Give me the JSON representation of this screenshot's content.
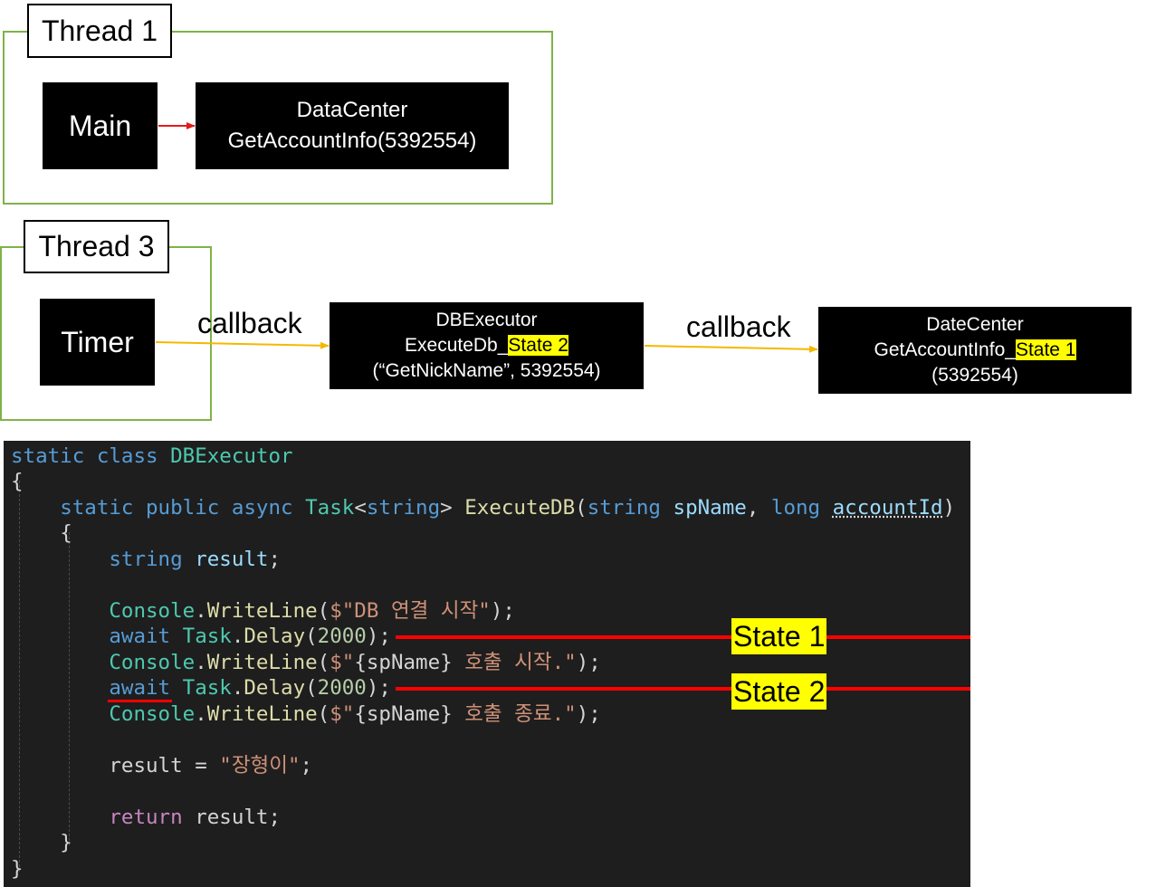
{
  "thread1": {
    "title": "Thread 1",
    "main_label": "Main",
    "datacenter": {
      "line1": "DataCenter",
      "line2": "GetAccountInfo(5392554)"
    }
  },
  "thread3": {
    "title": "Thread 3",
    "timer_label": "Timer",
    "callback1": "callback",
    "callback2": "callback",
    "dbexecutor": {
      "line1": "DBExecutor",
      "line2_prefix": "ExecuteDb_",
      "line2_state": "State 2",
      "line3": "(“GetNickName”, 5392554)"
    },
    "datecenter": {
      "line1": "DateCenter",
      "line2_prefix": "GetAccountInfo_",
      "line2_state": "State 1",
      "line3": "(5392554)"
    }
  },
  "code": {
    "l1_static": "static",
    "l1_class": "class",
    "l1_name": "DBExecutor",
    "brace_open": "{",
    "l3_static": "static",
    "l3_public": "public",
    "l3_async": "async",
    "l3_task": "Task",
    "l3_lt": "<",
    "l3_string": "string",
    "l3_gt": ">",
    "l3_method": "ExecuteDB",
    "l3_paren": "(",
    "l3_string2": "string",
    "l3_p1": "spName",
    "l3_comma": ",",
    "l3_long": "long",
    "l3_p2": "accountId",
    "l3_close": ")",
    "l4_brace": "{",
    "l5_string": "string",
    "l5_var": "result",
    "l5_semi": ";",
    "l7_console": "Console",
    "l7_dot": ".",
    "l7_write": "WriteLine",
    "l7_open": "(",
    "l7_str": "$\"DB 연결 시작\"",
    "l7_close": ");",
    "l8_await": "await",
    "l8_task": "Task",
    "l8_dot": ".",
    "l8_delay": "Delay",
    "l8_open": "(",
    "l8_num": "2000",
    "l8_close": ");",
    "l9_console": "Console",
    "l9_dot": ".",
    "l9_write": "WriteLine",
    "l9_open": "(",
    "l9_s1": "$\"",
    "l9_interp": "{spName}",
    "l9_s2": " 호출 시작.\"",
    "l9_close": ");",
    "l10_await": "await",
    "l10_task": "Task",
    "l10_dot": ".",
    "l10_delay": "Delay",
    "l10_open": "(",
    "l10_num": "2000",
    "l10_close": ");",
    "l11_console": "Console",
    "l11_dot": ".",
    "l11_write": "WriteLine",
    "l11_open": "(",
    "l11_s1": "$\"",
    "l11_interp": "{spName}",
    "l11_s2": " 호출 종료.\"",
    "l11_close": ");",
    "l13_var": "result",
    "l13_eq": " = ",
    "l13_str": "\"장형이\"",
    "l13_semi": ";",
    "l15_return": "return",
    "l15_var": "result",
    "l15_semi": ";",
    "l16_brace": "}",
    "l17_brace": "}"
  },
  "annotations": {
    "state1": "State 1",
    "state2": "State 2",
    "line_color": "#ff0000",
    "highlight_color": "#ffff00"
  }
}
